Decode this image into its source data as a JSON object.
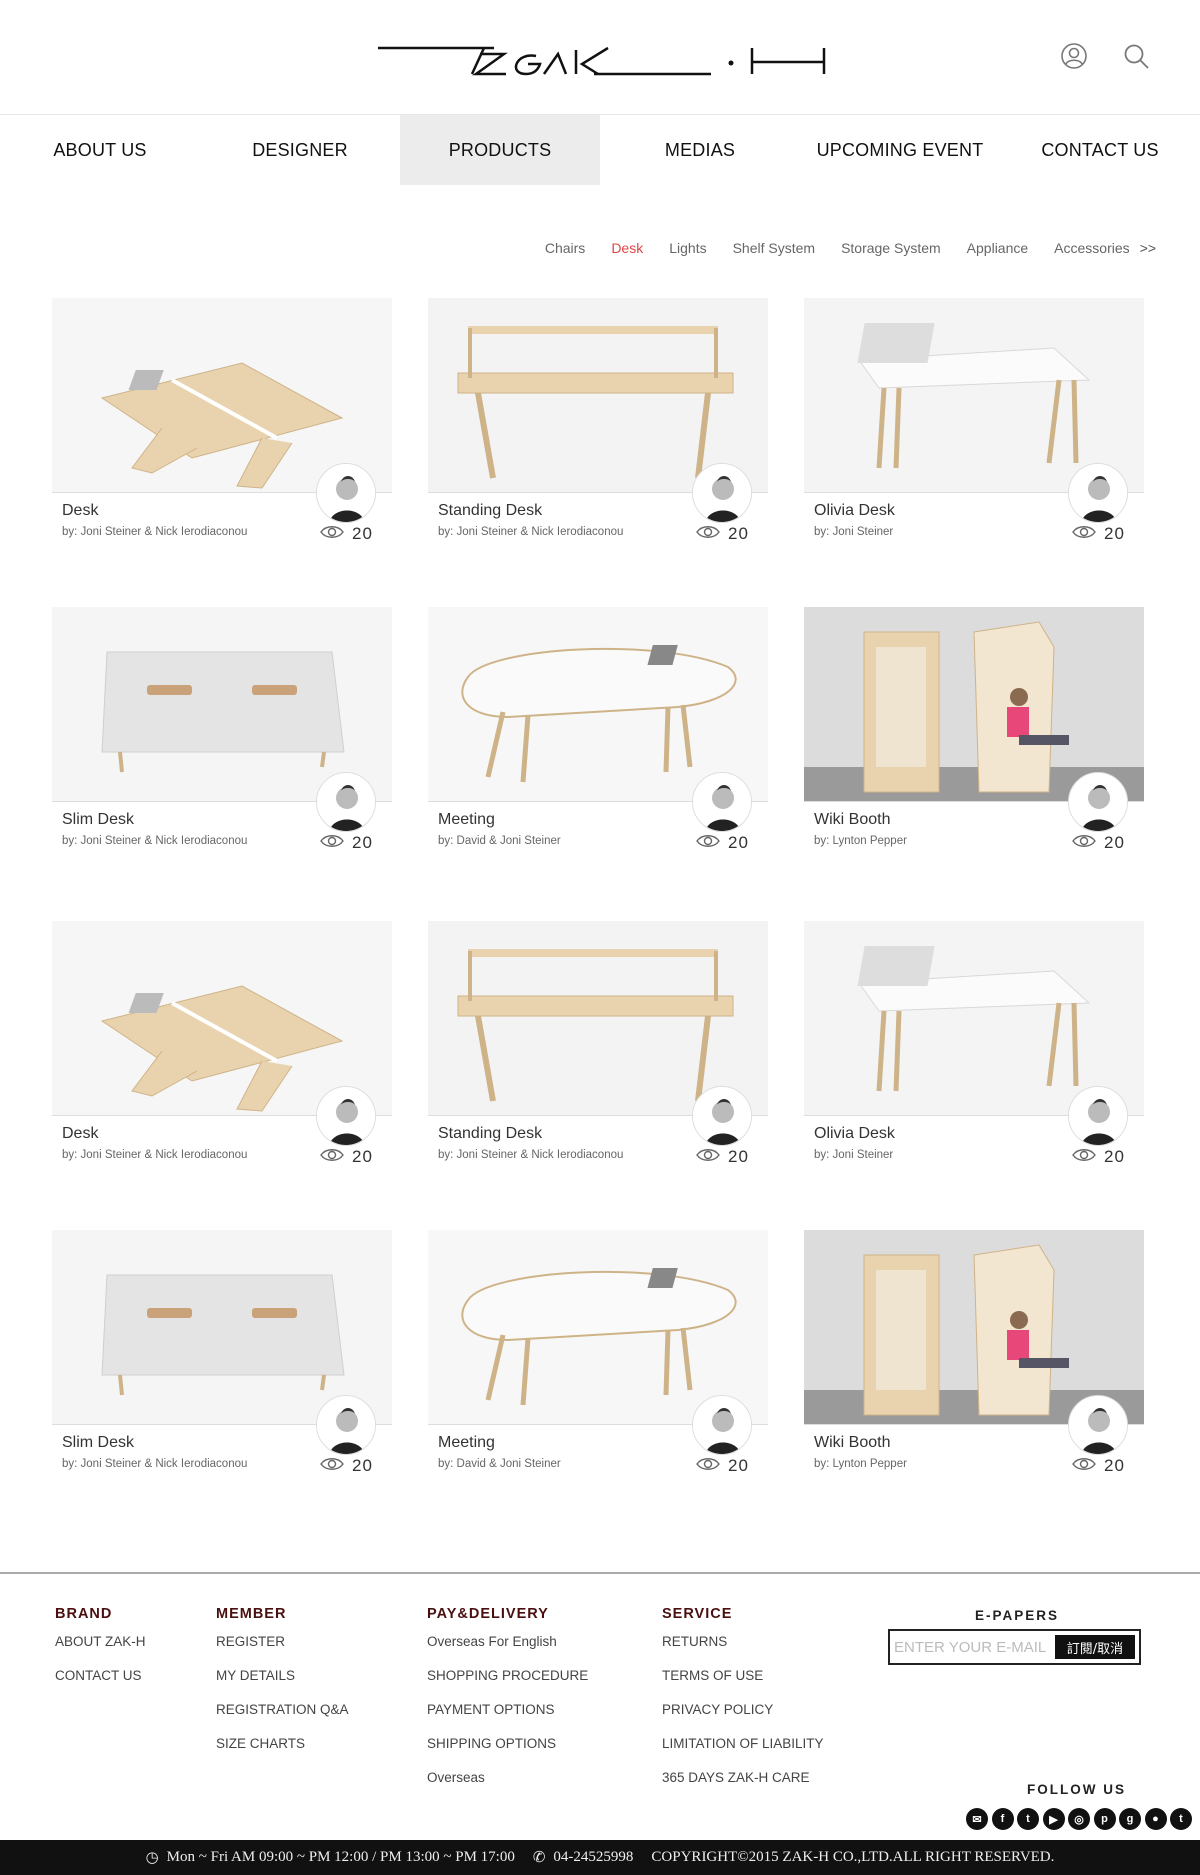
{
  "header": {
    "logo_text": "ZAK·H",
    "icons": [
      "user-icon",
      "search-icon"
    ]
  },
  "nav": {
    "items": [
      "ABOUT US",
      "DESIGNER",
      "PRODUCTS",
      "MEDIAS",
      "UPCOMING EVENT",
      "CONTACT US"
    ],
    "active": "PRODUCTS"
  },
  "filter": {
    "items": [
      "Chairs",
      "Desk",
      "Lights",
      "Shelf System",
      "Storage System",
      "Appliance",
      "Accessories"
    ],
    "selected": "Desk",
    "more": ">>",
    "selected_color": "#e0454a"
  },
  "products": [
    {
      "name": "Desk",
      "by": "by: Joni Steiner & Nick Ierodiaconou",
      "views": "20"
    },
    {
      "name": "Standing Desk",
      "by": "by: Joni Steiner & Nick Ierodiaconou",
      "views": "20"
    },
    {
      "name": "Olivia Desk",
      "by": "by: Joni Steiner",
      "views": "20"
    },
    {
      "name": "Slim Desk",
      "by": "by: Joni Steiner & Nick Ierodiaconou",
      "views": "20"
    },
    {
      "name": "Meeting",
      "by": "by: David & Joni Steiner",
      "views": "20"
    },
    {
      "name": "Wiki Booth",
      "by": "by: Lynton Pepper",
      "views": "20"
    },
    {
      "name": "Desk",
      "by": "by: Joni Steiner & Nick Ierodiaconou",
      "views": "20"
    },
    {
      "name": "Standing Desk",
      "by": "by: Joni Steiner & Nick Ierodiaconou",
      "views": "20"
    },
    {
      "name": "Olivia Desk",
      "by": "by: Joni Steiner",
      "views": "20"
    },
    {
      "name": "Slim Desk",
      "by": "by: Joni Steiner & Nick Ierodiaconou",
      "views": "20"
    },
    {
      "name": "Meeting",
      "by": "by: David & Joni Steiner",
      "views": "20"
    },
    {
      "name": "Wiki Booth",
      "by": "by: Lynton Pepper",
      "views": "20"
    }
  ],
  "footer": {
    "brand": {
      "title": "BRAND",
      "links": [
        "ABOUT ZAK-H",
        "CONTACT US"
      ]
    },
    "member": {
      "title": "MEMBER",
      "links": [
        "REGISTER",
        "MY DETAILS",
        "REGISTRATION Q&A",
        "SIZE CHARTS"
      ]
    },
    "pay": {
      "title": "PAY&DELIVERY",
      "links": [
        "Overseas For English",
        "SHOPPING PROCEDURE",
        "PAYMENT OPTIONS",
        "SHIPPING OPTIONS",
        "Overseas"
      ]
    },
    "service": {
      "title": "SERVICE",
      "links": [
        "RETURNS",
        "TERMS OF USE",
        "PRIVACY POLICY",
        "LIMITATION OF LIABILITY",
        "365 DAYS ZAK-H CARE"
      ]
    },
    "epapers": {
      "title": "E-PAPERS",
      "placeholder": "ENTER YOUR E-MAIL",
      "button": "訂閱/取消"
    },
    "follow": "FOLLOW US",
    "socials": [
      "mail-icon",
      "facebook-icon",
      "twitter-icon",
      "youtube-icon",
      "instagram-icon",
      "pinterest-icon",
      "google-plus-icon",
      "line-icon",
      "tumblr-icon"
    ]
  },
  "bottom_bar": {
    "hours": "Mon ~ Fri AM 09:00 ~ PM 12:00 / PM 13:00 ~ PM 17:00",
    "phone": "04-24525998",
    "copyright": "COPYRIGHT©2015  ZAK-H  CO.,LTD.ALL RIGHT RESERVED."
  }
}
